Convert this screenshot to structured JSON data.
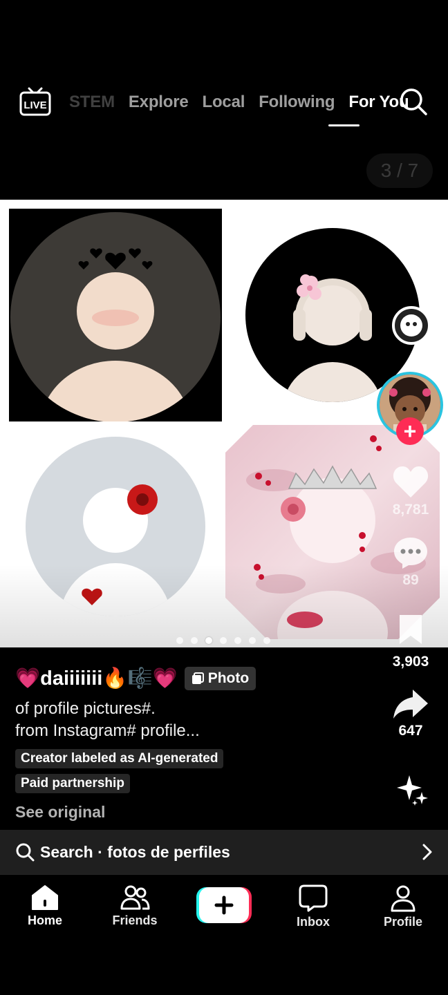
{
  "top_nav": {
    "live_label": "LIVE",
    "tabs": [
      "STEM",
      "Explore",
      "Local",
      "Following",
      "For You"
    ],
    "active_tab": "For You",
    "counter": "3 / 7"
  },
  "carousel": {
    "total": 7,
    "active_index": 3
  },
  "actions": {
    "likes": "8,781",
    "comments": "89",
    "saves": "3,903",
    "shares": "647"
  },
  "post": {
    "username": "💗daiiiiiii🔥🎼💗",
    "badge": "Photo",
    "description_line1": "of profile pictures#.",
    "description_line2": "from Instagram# profile...",
    "tag_ai": "Creator labeled as AI-generated",
    "tag_paid": "Paid partnership",
    "see_original": "See original"
  },
  "search_bar": {
    "text": "Search · fotos de perfiles"
  },
  "bottom_nav": {
    "home": "Home",
    "friends": "Friends",
    "inbox": "Inbox",
    "profile": "Profile"
  },
  "colors": {
    "accent_red": "#fe2c55",
    "accent_cyan": "#25f4ee",
    "background": "#000000"
  }
}
